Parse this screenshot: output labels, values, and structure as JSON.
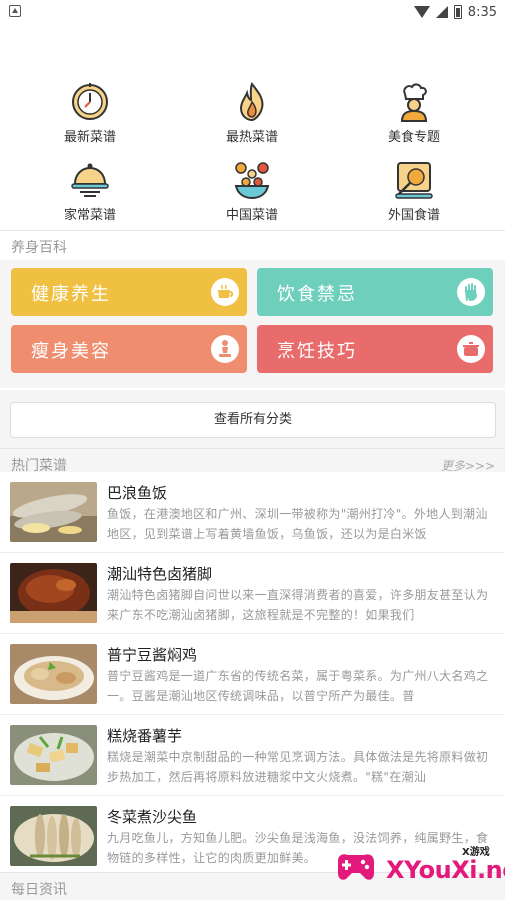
{
  "status_bar": {
    "time": "8:35"
  },
  "menu": [
    {
      "label": "最新菜谱",
      "icon": "clock-icon"
    },
    {
      "label": "最热菜谱",
      "icon": "flame-icon"
    },
    {
      "label": "美食专题",
      "icon": "chef-icon"
    },
    {
      "label": "家常菜谱",
      "icon": "cloche-icon"
    },
    {
      "label": "中国菜谱",
      "icon": "dishes-icon"
    },
    {
      "label": "外国食谱",
      "icon": "foreign-food-icon"
    }
  ],
  "health": {
    "title": "养身百科",
    "tiles": [
      {
        "label": "健康养生",
        "color": "#f0c043",
        "icon": "cup-icon"
      },
      {
        "label": "饮食禁忌",
        "color": "#6fcfbd",
        "icon": "hand-stop-icon"
      },
      {
        "label": "瘦身美容",
        "color": "#ee8e6f",
        "icon": "person-icon"
      },
      {
        "label": "烹饪技巧",
        "color": "#e96c6c",
        "icon": "pot-icon"
      }
    ],
    "all_button": "查看所有分类"
  },
  "hot": {
    "title": "热门菜谱",
    "more": "更多>>>",
    "items": [
      {
        "title": "巴浪鱼饭",
        "desc": "鱼饭，在港澳地区和广州、深圳一带被称为\"潮州打冷\"。外地人到潮汕地区，见到菜谱上写着黄墙鱼饭，乌鱼饭，还以为是白米饭"
      },
      {
        "title": "潮汕特色卤猪脚",
        "desc": "潮汕特色卤猪脚自问世以来一直深得消费者的喜爱，许多朋友甚至认为来广东不吃潮汕卤猪脚，这旅程就是不完整的！如果我们"
      },
      {
        "title": "普宁豆酱焖鸡",
        "desc": "普宁豆酱鸡是一道广东省的传统名菜，属于粤菜系。为广州八大名鸡之一。豆酱是潮汕地区传统调味品，以普宁所产为最佳。普"
      },
      {
        "title": "糕烧番薯芋",
        "desc": "糕烧是潮菜中京制甜品的一种常见烹调方法。具体做法是先将原料做初步热加工，然后再将原料放进糖浆中文火烧煮。\"糕\"在潮汕"
      },
      {
        "title": "冬菜煮沙尖鱼",
        "desc": "九月吃鱼儿，方知鱼儿肥。沙尖鱼是浅海鱼，没法饲养，纯属野生，食物链的多样性，让它的肉质更加鲜美。"
      }
    ]
  },
  "daily": {
    "title": "每日资讯"
  },
  "watermark": {
    "site": "XYouXi.net",
    "tag": "X游戏"
  }
}
